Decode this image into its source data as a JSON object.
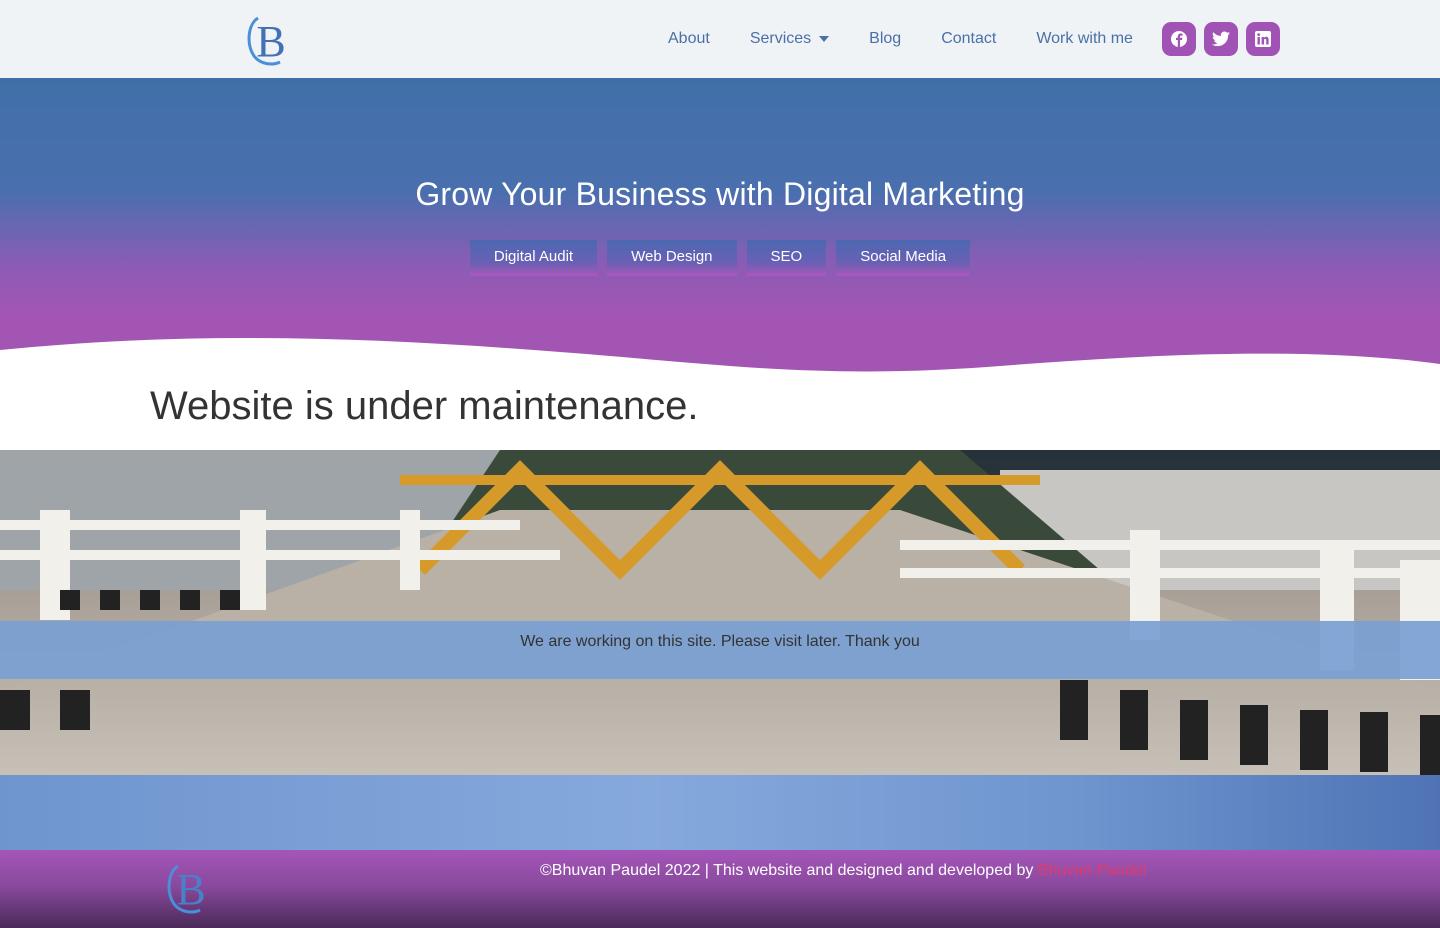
{
  "header": {
    "logo_letter": "B",
    "nav": [
      {
        "label": "About"
      },
      {
        "label": "Services"
      },
      {
        "label": "Blog"
      },
      {
        "label": "Contact"
      },
      {
        "label": "Work with me"
      }
    ],
    "socials": [
      "facebook-icon",
      "twitter-icon",
      "linkedin-icon"
    ]
  },
  "hero": {
    "title": "Grow Your Business with Digital Marketing",
    "pills": [
      "Digital Audit",
      "Web Design",
      "SEO",
      "Social Media"
    ]
  },
  "main": {
    "heading": "Website is under maintenance.",
    "notice": "We are working on this site. Please visit later. Thank you"
  },
  "footer": {
    "copyright": "©Bhuvan Paudel 2022 | This website and designed and developed by",
    "author_link": "Bhuvan Paudel"
  },
  "colors": {
    "accent_purple": "#a153b5",
    "nav_blue": "#4a70a8",
    "link_pink": "#e03a6e"
  }
}
